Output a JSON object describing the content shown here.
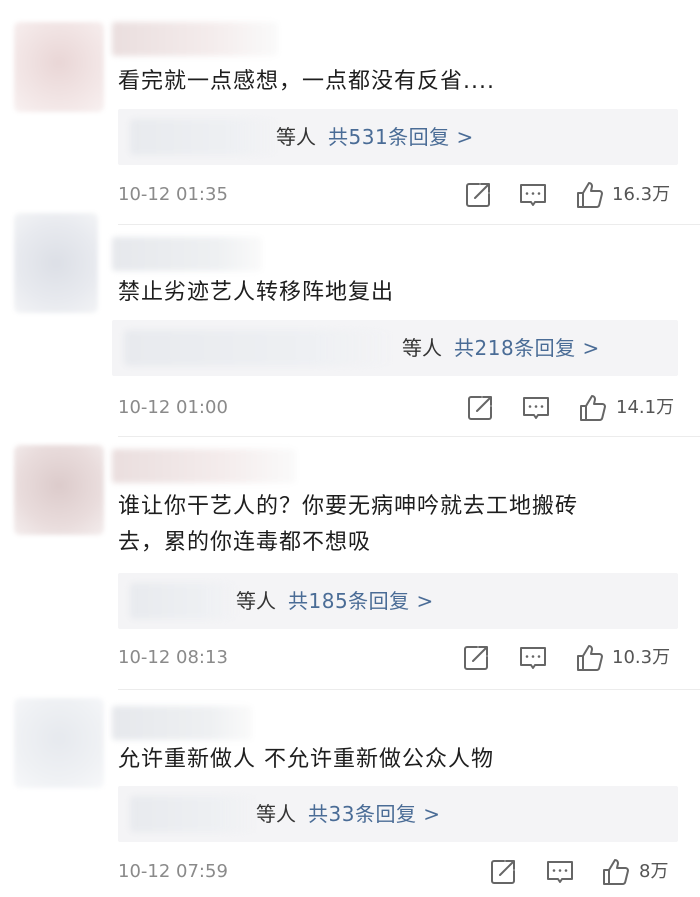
{
  "comments": [
    {
      "content": "看完就一点感想，一点都没有反省....",
      "replies_suffix": "等人",
      "replies_count": "共531条回复 >",
      "time": "10-12 01:35",
      "likes": "16.3万"
    },
    {
      "content": "禁止劣迹艺人转移阵地复出",
      "replies_suffix": "等人",
      "replies_count": "共218条回复 >",
      "time": "10-12 01:00",
      "likes": "14.1万"
    },
    {
      "content_line1": "谁让你干艺人的？你要无病呻吟就去工地搬砖",
      "content_line2": "去，累的你连毒都不想吸",
      "replies_suffix": "等人",
      "replies_count": "共185条回复 >",
      "time": "10-12 08:13",
      "likes": "10.3万"
    },
    {
      "content": "允许重新做人 不允许重新做公众人物",
      "replies_suffix": "等人",
      "replies_count": "共33条回复 >",
      "time": "10-12 07:59",
      "likes": "8万"
    }
  ],
  "icons": {
    "share": "share-icon",
    "comment": "comment-icon",
    "like": "thumbs-up-icon"
  },
  "colors": {
    "reply_link": "#4a6c96",
    "meta_gray": "#8a8a8a",
    "reply_bg": "#f4f4f6"
  }
}
